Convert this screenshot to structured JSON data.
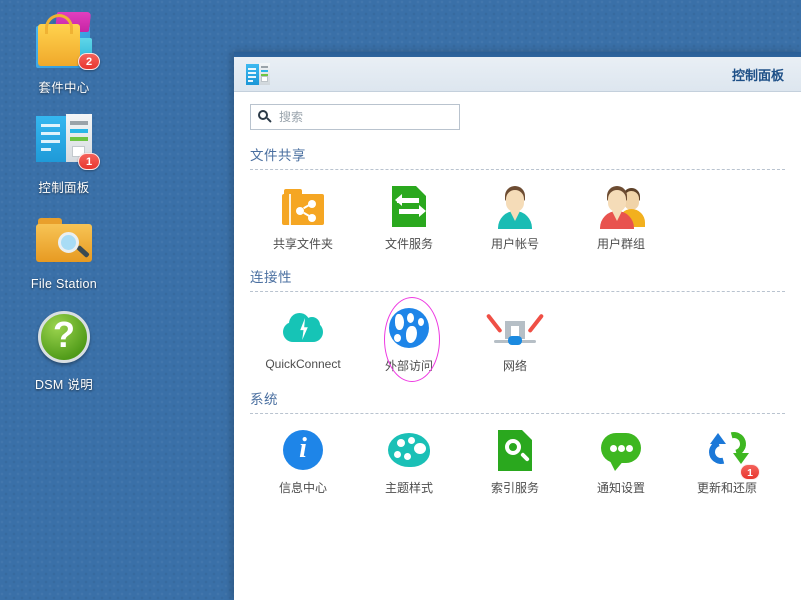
{
  "desktop": {
    "icons": [
      {
        "name": "package-center",
        "label": "套件中心",
        "badge": "2"
      },
      {
        "name": "control-panel",
        "label": "控制面板",
        "badge": "1"
      },
      {
        "name": "file-station",
        "label": "File Station",
        "badge": ""
      },
      {
        "name": "dsm-help",
        "label": "DSM 说明",
        "badge": ""
      }
    ]
  },
  "window": {
    "title": "控制面板",
    "icon": "control-panel-icon",
    "search": {
      "placeholder": "搜索",
      "value": "",
      "icon": "search-icon"
    },
    "sections": [
      {
        "title": "文件共享",
        "items": [
          {
            "label": "共享文件夹",
            "icon": "shared-folder-icon",
            "highlighted": false,
            "badge": ""
          },
          {
            "label": "文件服务",
            "icon": "file-service-icon",
            "highlighted": false,
            "badge": ""
          },
          {
            "label": "用户帐号",
            "icon": "user-account-icon",
            "highlighted": false,
            "badge": ""
          },
          {
            "label": "用户群组",
            "icon": "user-group-icon",
            "highlighted": false,
            "badge": ""
          }
        ]
      },
      {
        "title": "连接性",
        "items": [
          {
            "label": "QuickConnect",
            "icon": "quickconnect-icon",
            "highlighted": false,
            "badge": ""
          },
          {
            "label": "外部访问",
            "icon": "external-access-icon",
            "highlighted": true,
            "badge": ""
          },
          {
            "label": "网络",
            "icon": "network-icon",
            "highlighted": false,
            "badge": ""
          }
        ]
      },
      {
        "title": "系统",
        "items": [
          {
            "label": "信息中心",
            "icon": "info-center-icon",
            "highlighted": false,
            "badge": ""
          },
          {
            "label": "主题样式",
            "icon": "theme-style-icon",
            "highlighted": false,
            "badge": ""
          },
          {
            "label": "索引服务",
            "icon": "index-service-icon",
            "highlighted": false,
            "badge": ""
          },
          {
            "label": "通知设置",
            "icon": "notification-icon",
            "highlighted": false,
            "badge": ""
          },
          {
            "label": "更新和还原",
            "icon": "update-restore-icon",
            "highlighted": false,
            "badge": "1"
          }
        ]
      }
    ]
  },
  "colors": {
    "desktop_blue": "#3a70a8",
    "title_blue": "#1d4f87",
    "section_label": "#4a6fa0",
    "highlight_ring": "#ee3ae2",
    "badge_red": "#e8362e"
  }
}
